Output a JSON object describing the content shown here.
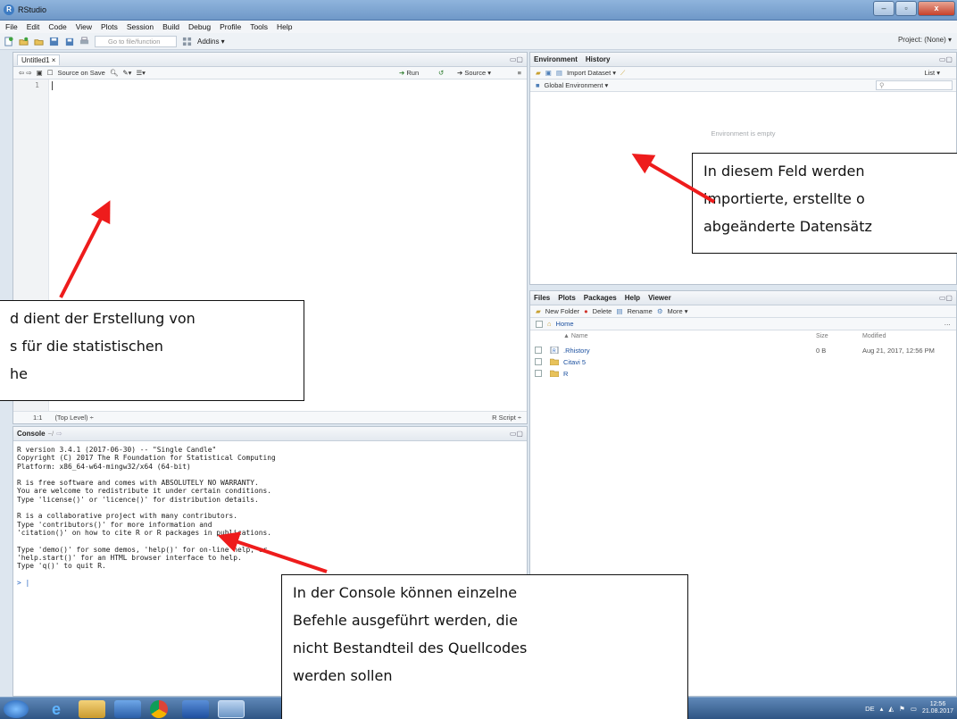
{
  "window": {
    "title": "RStudio"
  },
  "menu": [
    "File",
    "Edit",
    "Code",
    "View",
    "Plots",
    "Session",
    "Build",
    "Debug",
    "Profile",
    "Tools",
    "Help"
  ],
  "toolbar": {
    "goto_placeholder": "Go to file/function",
    "addins": "Addins ▾",
    "project": "Project: (None) ▾"
  },
  "editor": {
    "tab": "Untitled1 ×",
    "source_on_save": "Source on Save",
    "run": "Run",
    "source": "Source ▾",
    "line_number": "1",
    "cursor_pos": "1:1",
    "scope": "(Top Level) ÷",
    "file_type": "R Script ÷"
  },
  "console": {
    "tab": "Console",
    "path": "~/",
    "lines": [
      "R version 3.4.1 (2017-06-30) -- \"Single Candle\"",
      "Copyright (C) 2017 The R Foundation for Statistical Computing",
      "Platform: x86_64-w64-mingw32/x64 (64-bit)",
      "",
      "R is free software and comes with ABSOLUTELY NO WARRANTY.",
      "You are welcome to redistribute it under certain conditions.",
      "Type 'license()' or 'licence()' for distribution details.",
      "",
      "R is a collaborative project with many contributors.",
      "Type 'contributors()' for more information and",
      "'citation()' on how to cite R or R packages in publications.",
      "",
      "Type 'demo()' for some demos, 'help()' for on-line help, or",
      "'help.start()' for an HTML browser interface to help.",
      "Type 'q()' to quit R.",
      ""
    ],
    "prompt": ">"
  },
  "environment": {
    "tabs": [
      "Environment",
      "History"
    ],
    "import_dataset": "Import Dataset ▾",
    "list_view": "List ▾",
    "scope": "Global Environment ▾",
    "empty_message": "Environment is empty"
  },
  "files": {
    "tabs": [
      "Files",
      "Plots",
      "Packages",
      "Help",
      "Viewer"
    ],
    "new_folder": "New Folder",
    "delete": "Delete",
    "rename": "Rename",
    "more": "More ▾",
    "breadcrumb": "Home",
    "columns": {
      "name": "▲ Name",
      "size": "Size",
      "modified": "Modified"
    },
    "rows": [
      {
        "name": ".Rhistory",
        "size": "0 B",
        "modified": "Aug 21, 2017, 12:56 PM"
      },
      {
        "name": "Citavi 5",
        "size": "",
        "modified": ""
      },
      {
        "name": "R",
        "size": "",
        "modified": ""
      }
    ]
  },
  "callouts": {
    "editor": [
      "d dient der Erstellung von",
      "s für die statistischen",
      "he"
    ],
    "environment": [
      "In diesem Feld werden",
      "importierte, erstellte o",
      "abgeänderte Datensätz"
    ],
    "console": [
      "In der Console können einzelne",
      "Befehle ausgeführt werden, die",
      "nicht Bestandteil des Quellcodes",
      "werden sollen"
    ]
  },
  "taskbar": {
    "lang": "DE",
    "time": "12:56",
    "date": "21.08.2017"
  },
  "colors": {
    "arrow": "#ee1c1c",
    "titlebar": "#7aa2d0",
    "taskbar": "#3f6896"
  }
}
